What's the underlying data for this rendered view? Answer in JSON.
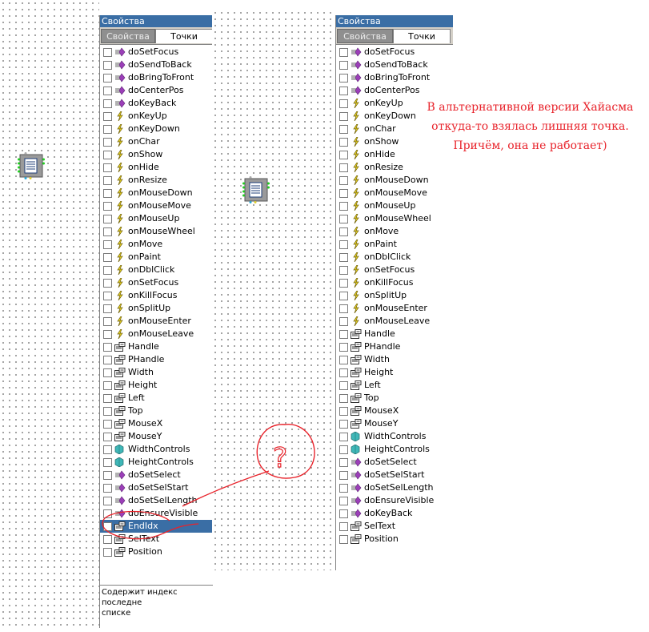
{
  "left_panel": {
    "title": "Свойства",
    "tabs": [
      "Свойства",
      "Точки"
    ],
    "items": [
      {
        "label": "doSetFocus",
        "icon": "method-icon"
      },
      {
        "label": "doSendToBack",
        "icon": "method-icon"
      },
      {
        "label": "doBringToFront",
        "icon": "method-icon"
      },
      {
        "label": "doCenterPos",
        "icon": "method-icon"
      },
      {
        "label": "doKeyBack",
        "icon": "method-icon"
      },
      {
        "label": "onKeyUp",
        "icon": "event-icon"
      },
      {
        "label": "onKeyDown",
        "icon": "event-icon"
      },
      {
        "label": "onChar",
        "icon": "event-icon"
      },
      {
        "label": "onShow",
        "icon": "event-icon"
      },
      {
        "label": "onHide",
        "icon": "event-icon"
      },
      {
        "label": "onResize",
        "icon": "event-icon"
      },
      {
        "label": "onMouseDown",
        "icon": "event-icon"
      },
      {
        "label": "onMouseMove",
        "icon": "event-icon"
      },
      {
        "label": "onMouseUp",
        "icon": "event-icon"
      },
      {
        "label": "onMouseWheel",
        "icon": "event-icon"
      },
      {
        "label": "onMove",
        "icon": "event-icon"
      },
      {
        "label": "onPaint",
        "icon": "event-icon"
      },
      {
        "label": "onDblClick",
        "icon": "event-icon"
      },
      {
        "label": "onSetFocus",
        "icon": "event-icon"
      },
      {
        "label": "onKillFocus",
        "icon": "event-icon"
      },
      {
        "label": "onSplitUp",
        "icon": "event-icon"
      },
      {
        "label": "onMouseEnter",
        "icon": "event-icon"
      },
      {
        "label": "onMouseLeave",
        "icon": "event-icon"
      },
      {
        "label": "Handle",
        "icon": "data-icon"
      },
      {
        "label": "PHandle",
        "icon": "data-icon"
      },
      {
        "label": "Width",
        "icon": "data-icon"
      },
      {
        "label": "Height",
        "icon": "data-icon"
      },
      {
        "label": "Left",
        "icon": "data-icon"
      },
      {
        "label": "Top",
        "icon": "data-icon"
      },
      {
        "label": "MouseX",
        "icon": "data-icon"
      },
      {
        "label": "MouseY",
        "icon": "data-icon"
      },
      {
        "label": "WidthControls",
        "icon": "var-icon"
      },
      {
        "label": "HeightControls",
        "icon": "var-icon"
      },
      {
        "label": "doSetSelect",
        "icon": "method-icon"
      },
      {
        "label": "doSetSelStart",
        "icon": "method-icon"
      },
      {
        "label": "doSetSelLength",
        "icon": "method-icon"
      },
      {
        "label": "doEnsureVisible",
        "icon": "method-icon"
      },
      {
        "label": "EndIdx",
        "icon": "data-icon",
        "selected": true
      },
      {
        "label": "SelText",
        "icon": "data-icon"
      },
      {
        "label": "Position",
        "icon": "data-icon"
      }
    ],
    "description": "Содержит индекс последне\nсписке"
  },
  "right_panel": {
    "title": "Свойства",
    "tabs": [
      "Свойства",
      "Точки"
    ],
    "items": [
      {
        "label": "doSetFocus",
        "icon": "method-icon"
      },
      {
        "label": "doSendToBack",
        "icon": "method-icon"
      },
      {
        "label": "doBringToFront",
        "icon": "method-icon"
      },
      {
        "label": "doCenterPos",
        "icon": "method-icon"
      },
      {
        "label": "onKeyUp",
        "icon": "event-icon"
      },
      {
        "label": "onKeyDown",
        "icon": "event-icon"
      },
      {
        "label": "onChar",
        "icon": "event-icon"
      },
      {
        "label": "onShow",
        "icon": "event-icon"
      },
      {
        "label": "onHide",
        "icon": "event-icon"
      },
      {
        "label": "onResize",
        "icon": "event-icon"
      },
      {
        "label": "onMouseDown",
        "icon": "event-icon"
      },
      {
        "label": "onMouseMove",
        "icon": "event-icon"
      },
      {
        "label": "onMouseUp",
        "icon": "event-icon"
      },
      {
        "label": "onMouseWheel",
        "icon": "event-icon"
      },
      {
        "label": "onMove",
        "icon": "event-icon"
      },
      {
        "label": "onPaint",
        "icon": "event-icon"
      },
      {
        "label": "onDblClick",
        "icon": "event-icon"
      },
      {
        "label": "onSetFocus",
        "icon": "event-icon"
      },
      {
        "label": "onKillFocus",
        "icon": "event-icon"
      },
      {
        "label": "onSplitUp",
        "icon": "event-icon"
      },
      {
        "label": "onMouseEnter",
        "icon": "event-icon"
      },
      {
        "label": "onMouseLeave",
        "icon": "event-icon"
      },
      {
        "label": "Handle",
        "icon": "data-icon"
      },
      {
        "label": "PHandle",
        "icon": "data-icon"
      },
      {
        "label": "Width",
        "icon": "data-icon"
      },
      {
        "label": "Height",
        "icon": "data-icon"
      },
      {
        "label": "Left",
        "icon": "data-icon"
      },
      {
        "label": "Top",
        "icon": "data-icon"
      },
      {
        "label": "MouseX",
        "icon": "data-icon"
      },
      {
        "label": "MouseY",
        "icon": "data-icon"
      },
      {
        "label": "WidthControls",
        "icon": "var-icon"
      },
      {
        "label": "HeightControls",
        "icon": "var-icon"
      },
      {
        "label": "doSetSelect",
        "icon": "method-icon"
      },
      {
        "label": "doSetSelStart",
        "icon": "method-icon"
      },
      {
        "label": "doSetSelLength",
        "icon": "method-icon"
      },
      {
        "label": "doEnsureVisible",
        "icon": "method-icon"
      },
      {
        "label": "doKeyBack",
        "icon": "method-icon"
      },
      {
        "label": "SelText",
        "icon": "data-icon"
      },
      {
        "label": "Position",
        "icon": "data-icon"
      }
    ]
  },
  "annotation": {
    "lines": [
      "В альтернативной версии Хайасма",
      "откуда-то взялась лишняя точка.",
      "Причём, она не работает)"
    ],
    "question_mark": "?",
    "color": "#e8232b"
  },
  "colors": {
    "titlebar": "#3a6ea5",
    "selection": "#3a6ea5",
    "tab_bar": "#d4d0c8"
  }
}
